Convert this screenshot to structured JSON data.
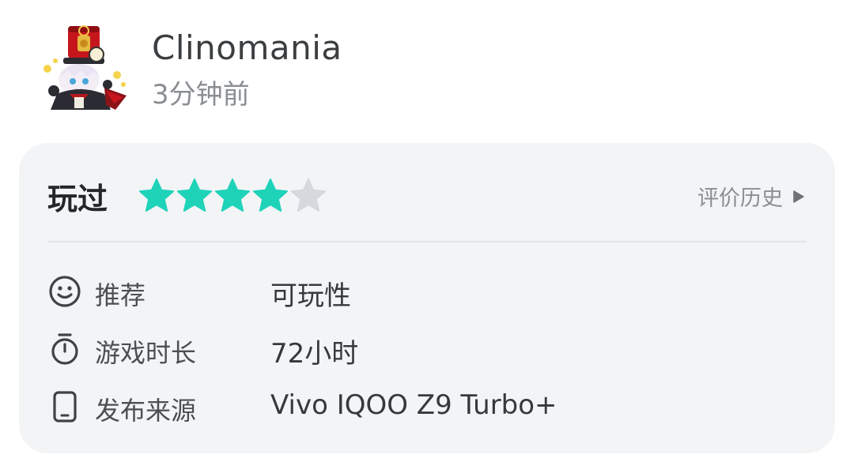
{
  "user": {
    "name": "Clinomania",
    "time_ago": "3分钟前",
    "avatar_icon": "chibi-character-avatar"
  },
  "review": {
    "status": "玩过",
    "rating": 4,
    "rating_max": 5,
    "star_color": "#1fd3b9",
    "star_empty_color": "#d5d8dc",
    "history_label": "评价历史",
    "history_icon": "play-triangle-icon"
  },
  "details": [
    {
      "icon": "smile-icon",
      "label": "推荐",
      "value": "可玩性"
    },
    {
      "icon": "stopwatch-icon",
      "label": "游戏时长",
      "value": "72小时"
    },
    {
      "icon": "phone-icon",
      "label": "发布来源",
      "value": "Vivo IQOO Z9 Turbo+"
    }
  ]
}
